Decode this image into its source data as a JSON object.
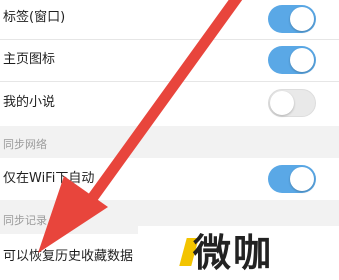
{
  "settings": {
    "rows": [
      {
        "label": "标签(窗口)",
        "toggle": "on"
      },
      {
        "label": "主页图标",
        "toggle": "on"
      },
      {
        "label": "我的小说",
        "toggle": "off"
      }
    ],
    "section_sync_network": "同步网络",
    "wifi_row": {
      "label": "仅在WiFi下自动",
      "toggle": "on"
    },
    "section_sync_records": "同步记录",
    "restore_row": {
      "label": "可以恢复历史收藏数据"
    }
  },
  "watermark": {
    "text": "微咖"
  },
  "colors": {
    "toggle_on": "#5aa8e6",
    "toggle_off": "#e9e9e9",
    "arrow": "#e8453c"
  }
}
